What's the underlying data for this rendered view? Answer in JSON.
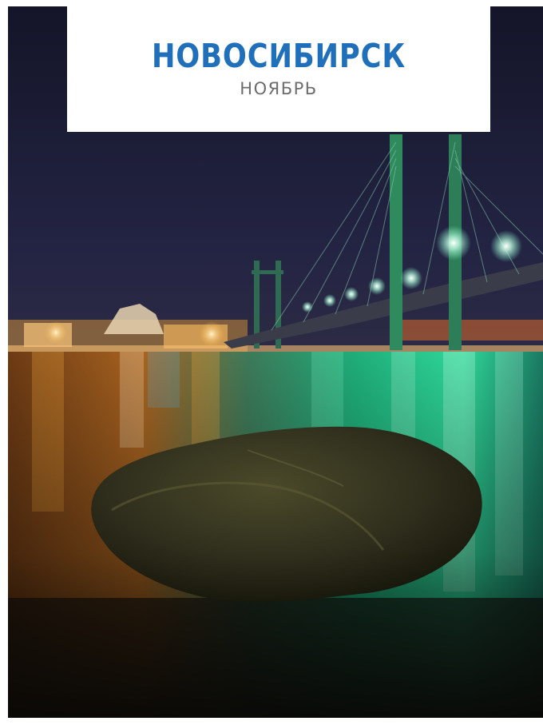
{
  "card": {
    "title": "НОВОСИБИРСК",
    "subtitle": "НОЯБРЬ"
  },
  "photo": {
    "subject": "night-bridge-river-rock",
    "colors": {
      "sky": "#1c1d36",
      "water_warm": "#e08a2a",
      "water_green": "#2fd79a",
      "rock": "#3a3a22",
      "title": "#1f6fba",
      "subtitle": "#6d6d6d"
    }
  }
}
